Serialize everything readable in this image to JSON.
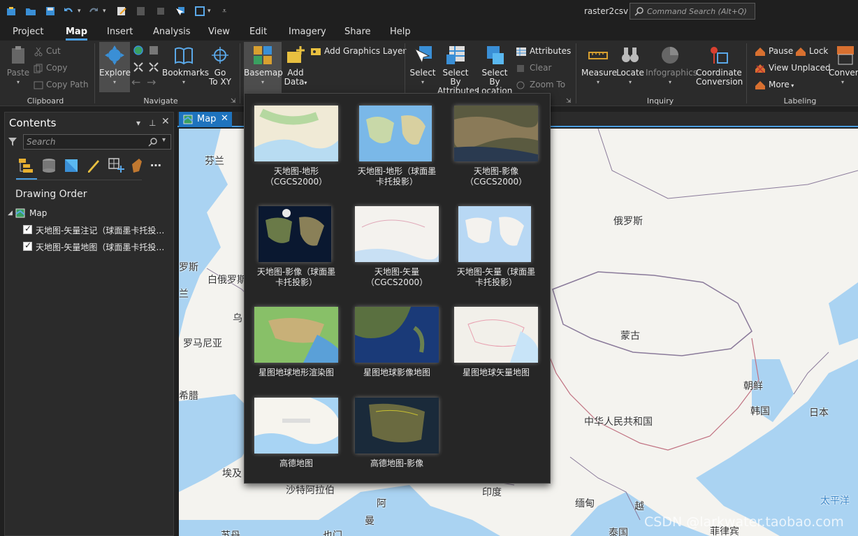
{
  "titlebar": {
    "title": "raster2csv",
    "search_placeholder": "Command Search (Alt+Q)"
  },
  "menu_tabs": [
    "Project",
    "Map",
    "Insert",
    "Analysis",
    "View",
    "Edit",
    "Imagery",
    "Share",
    "Help"
  ],
  "active_tab": "Map",
  "ribbon": {
    "clipboard": {
      "paste": "Paste",
      "cut": "Cut",
      "copy": "Copy",
      "copy_path": "Copy Path",
      "group": "Clipboard"
    },
    "navigate": {
      "explore": "Explore",
      "bookmarks": "Bookmarks",
      "go_to_xy_1": "Go",
      "go_to_xy_2": "To XY",
      "group": "Navigate"
    },
    "layer": {
      "basemap": "Basemap",
      "add_data_1": "Add",
      "add_data_2": "Data",
      "add_graphics_layer": "Add Graphics Layer"
    },
    "selection": {
      "select": "Select",
      "select_by_attr_1": "Select By",
      "select_by_attr_2": "Attributes",
      "select_by_loc_1": "Select By",
      "select_by_loc_2": "Location",
      "attributes": "Attributes",
      "clear": "Clear",
      "zoom_to": "Zoom To"
    },
    "inquiry": {
      "measure": "Measure",
      "locate": "Locate",
      "infographics": "Infographics",
      "coord_1": "Coordinate",
      "coord_2": "Conversion",
      "group": "Inquiry"
    },
    "labeling": {
      "pause": "Pause",
      "lock": "Lock",
      "view_unplaced": "View Unplaced",
      "more": "More",
      "convert": "Conver",
      "group": "Labeling"
    }
  },
  "contents": {
    "title": "Contents",
    "search_placeholder": "Search",
    "drawing_order": "Drawing Order",
    "map_node": "Map",
    "layers": [
      "天地图-矢量注记（球面墨卡托投…",
      "天地图-矢量地图（球面墨卡托投…"
    ]
  },
  "map_tab": {
    "label": "Map"
  },
  "basemaps": [
    {
      "line1": "天地图-地形",
      "line2": "（CGCS2000）"
    },
    {
      "line1": "天地图-地形（球面墨",
      "line2": "卡托投影）"
    },
    {
      "line1": "天地图-影像",
      "line2": "（CGCS2000）"
    },
    {
      "line1": "天地图-影像（球面墨",
      "line2": "卡托投影）"
    },
    {
      "line1": "天地图-矢量",
      "line2": "（CGCS2000）"
    },
    {
      "line1": "天地图-矢量（球面墨",
      "line2": "卡托投影）"
    },
    {
      "line1": "星图地球地形渲染图",
      "line2": ""
    },
    {
      "line1": "星图地球影像地图",
      "line2": ""
    },
    {
      "line1": "星图地球矢量地图",
      "line2": ""
    },
    {
      "line1": "高德地图",
      "line2": ""
    },
    {
      "line1": "高德地图-影像",
      "line2": ""
    }
  ],
  "map_labels": {
    "finland": "芬兰",
    "russia": "俄罗斯",
    "belarus": "白俄罗斯",
    "romania": "罗马尼亚",
    "greece": "希腊",
    "ukraine_frag": "乌",
    "mongolia": "蒙古",
    "china": "中华人民共和国",
    "nk": "朝鲜",
    "korea": "韩国",
    "japan": "日本",
    "egypt": "埃及",
    "saudi": "沙特阿拉伯",
    "india": "印度",
    "myanmar": "缅甸",
    "vietnam_frag": "越",
    "pacific": "太平洋",
    "afr_frag1": "阿",
    "afr_frag2": "曼",
    "frag_rus": "罗斯",
    "frag_e": "兰",
    "sudan": "苏丹",
    "yemen": "也门",
    "thailand": "泰国",
    "philippines": "菲律宾"
  },
  "watermark": "CSDN @larkwater.taobao.com"
}
